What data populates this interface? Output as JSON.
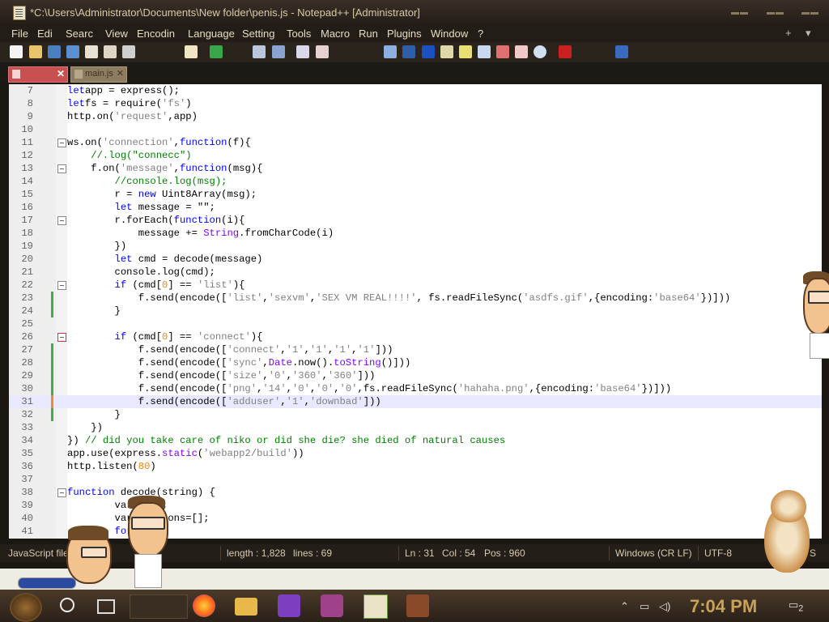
{
  "window": {
    "title": "*C:\\Users\\Administrator\\Documents\\New folder\\penis.js - Notepad++ [Administrator]"
  },
  "menu": {
    "items": [
      "File",
      "Edi",
      "Searc",
      "View",
      "Encodin",
      "Language",
      "Setting",
      "Tools",
      "Macro",
      "Run",
      "Plugins",
      "Window",
      "?"
    ],
    "right": [
      "+",
      "▾",
      "✕"
    ]
  },
  "tabs": [
    {
      "label": "",
      "active": true,
      "color": "#c95050"
    },
    {
      "label": "main.js",
      "active": false
    }
  ],
  "editor": {
    "current_line": 31,
    "lines": [
      {
        "n": 7,
        "t": [
          [
            "k",
            "let"
          ],
          [
            "",
            "app = express();"
          ]
        ]
      },
      {
        "n": 8,
        "t": [
          [
            "k",
            "let"
          ],
          [
            "",
            "fs = require("
          ],
          [
            "s",
            "'fs'"
          ],
          [
            "",
            ")"
          ]
        ]
      },
      {
        "n": 9,
        "t": [
          [
            "",
            "http.on("
          ],
          [
            "s",
            "'request'"
          ],
          [
            "",
            ",app)"
          ]
        ]
      },
      {
        "n": 10,
        "t": []
      },
      {
        "n": 11,
        "t": [
          [
            "",
            "ws.on("
          ],
          [
            "s",
            "'connection'"
          ],
          [
            "",
            ","
          ],
          [
            "k",
            "function"
          ],
          [
            "",
            "(f){"
          ]
        ],
        "fold": true
      },
      {
        "n": 12,
        "t": [
          [
            "c",
            "    //.log(\"connecc\")"
          ]
        ]
      },
      {
        "n": 13,
        "t": [
          [
            "",
            "    f.on("
          ],
          [
            "s",
            "'message'"
          ],
          [
            "",
            ","
          ],
          [
            "k",
            "function"
          ],
          [
            "",
            "(msg){"
          ]
        ],
        "fold": true
      },
      {
        "n": 14,
        "t": [
          [
            "c",
            "        //console.log(msg);"
          ]
        ]
      },
      {
        "n": 15,
        "t": [
          [
            "",
            "        r = "
          ],
          [
            "k",
            "new"
          ],
          [
            "",
            " Uint8Array(msg);"
          ]
        ]
      },
      {
        "n": 16,
        "t": [
          [
            "k",
            "        let"
          ],
          [
            "",
            " message = \"\";"
          ]
        ]
      },
      {
        "n": 17,
        "t": [
          [
            "",
            "        r.forEach("
          ],
          [
            "k",
            "function"
          ],
          [
            "",
            "(i){"
          ]
        ],
        "fold": true
      },
      {
        "n": 18,
        "t": [
          [
            "",
            "            message += "
          ],
          [
            "f",
            "String"
          ],
          [
            "",
            ".fromCharCode(i)"
          ]
        ]
      },
      {
        "n": 19,
        "t": [
          [
            "",
            "        })"
          ]
        ]
      },
      {
        "n": 20,
        "t": [
          [
            "k",
            "        let"
          ],
          [
            "",
            " cmd = decode(message)"
          ]
        ]
      },
      {
        "n": 21,
        "t": [
          [
            "",
            "        console.log(cmd);"
          ]
        ]
      },
      {
        "n": 22,
        "t": [
          [
            "k",
            "        if"
          ],
          [
            "",
            " (cmd["
          ],
          [
            "n",
            "0"
          ],
          [
            "",
            "] == "
          ],
          [
            "s",
            "'list'"
          ],
          [
            "",
            "){"
          ]
        ],
        "fold": true
      },
      {
        "n": 23,
        "t": [
          [
            "",
            "            f.send(encode(["
          ],
          [
            "s",
            "'list'"
          ],
          [
            "",
            ","
          ],
          [
            "s",
            "'sexvm'"
          ],
          [
            "",
            ","
          ],
          [
            "s",
            "'SEX VM REAL!!!!'"
          ],
          [
            "",
            ", fs.readFileSync("
          ],
          [
            "s",
            "'asdfs.gif'"
          ],
          [
            "",
            ",{encoding:"
          ],
          [
            "s",
            "'base64'"
          ],
          [
            "",
            "})]))"
          ]
        ],
        "mark": "#3cb043"
      },
      {
        "n": 24,
        "t": [
          [
            "",
            "        }"
          ]
        ],
        "mark": "#3cb043"
      },
      {
        "n": 25,
        "t": []
      },
      {
        "n": 26,
        "t": [
          [
            "k",
            "        if"
          ],
          [
            "",
            " (cmd["
          ],
          [
            "n",
            "0"
          ],
          [
            "",
            "] == "
          ],
          [
            "s",
            "'connect'"
          ],
          [
            "",
            "){"
          ]
        ],
        "fold": true,
        "foldRed": true
      },
      {
        "n": 27,
        "t": [
          [
            "",
            "            f.send(encode(["
          ],
          [
            "s",
            "'connect'"
          ],
          [
            "",
            ","
          ],
          [
            "s",
            "'1'"
          ],
          [
            "",
            ","
          ],
          [
            "s",
            "'1'"
          ],
          [
            "",
            ","
          ],
          [
            "s",
            "'1'"
          ],
          [
            "",
            ","
          ],
          [
            "s",
            "'1'"
          ],
          [
            "",
            "]))"
          ]
        ],
        "mark": "#3cb043"
      },
      {
        "n": 28,
        "t": [
          [
            "",
            "            f.send(encode(["
          ],
          [
            "s",
            "'sync'"
          ],
          [
            "",
            ","
          ],
          [
            "f",
            "Date"
          ],
          [
            "",
            ".now()."
          ],
          [
            "f",
            "toString"
          ],
          [
            "",
            "()]))"
          ]
        ],
        "mark": "#3cb043"
      },
      {
        "n": 29,
        "t": [
          [
            "",
            "            f.send(encode(["
          ],
          [
            "s",
            "'size'"
          ],
          [
            "",
            ","
          ],
          [
            "s",
            "'0'"
          ],
          [
            "",
            ","
          ],
          [
            "s",
            "'360'"
          ],
          [
            "",
            ","
          ],
          [
            "s",
            "'360'"
          ],
          [
            "",
            "]))"
          ]
        ],
        "mark": "#3cb043"
      },
      {
        "n": 30,
        "t": [
          [
            "",
            "            f.send(encode(["
          ],
          [
            "s",
            "'png'"
          ],
          [
            "",
            ","
          ],
          [
            "s",
            "'14'"
          ],
          [
            "",
            ","
          ],
          [
            "s",
            "'0'"
          ],
          [
            "",
            ","
          ],
          [
            "s",
            "'0'"
          ],
          [
            "",
            ","
          ],
          [
            "s",
            "'0'"
          ],
          [
            "",
            ",fs.readFileSync("
          ],
          [
            "s",
            "'hahaha.png'"
          ],
          [
            "",
            ",{encoding:"
          ],
          [
            "s",
            "'base64'"
          ],
          [
            "",
            "})]))"
          ]
        ],
        "mark": "#3cb043"
      },
      {
        "n": 31,
        "t": [
          [
            "",
            "            f.send(encode(["
          ],
          [
            "s",
            "'adduser'"
          ],
          [
            "",
            ","
          ],
          [
            "s",
            "'1'"
          ],
          [
            "",
            ","
          ],
          [
            "s",
            "'downbad'"
          ],
          [
            "",
            "]))"
          ]
        ],
        "mark": "#f08a24"
      },
      {
        "n": 32,
        "t": [
          [
            "",
            "        }"
          ]
        ],
        "mark": "#3cb043"
      },
      {
        "n": 33,
        "t": [
          [
            "",
            "    })"
          ]
        ]
      },
      {
        "n": 34,
        "t": [
          [
            "",
            "}) "
          ],
          [
            "c",
            "// did you take care of niko or did she die? she died of natural causes"
          ]
        ]
      },
      {
        "n": 35,
        "t": [
          [
            "",
            "app.use(express."
          ],
          [
            "f",
            "static"
          ],
          [
            "",
            "("
          ],
          [
            "s",
            "'webapp2/build'"
          ],
          [
            "",
            "))"
          ]
        ]
      },
      {
        "n": 36,
        "t": [
          [
            "",
            "http.listen("
          ],
          [
            "n",
            "80"
          ],
          [
            "",
            ")"
          ]
        ]
      },
      {
        "n": 37,
        "t": []
      },
      {
        "n": 38,
        "t": [
          [
            "k",
            "function"
          ],
          [
            "",
            " decode(string) {"
          ]
        ],
        "fold": true
      },
      {
        "n": 39,
        "t": [
          [
            "",
            "        va"
          ],
          [
            "",
            "r x=-"
          ],
          [
            "n",
            "1"
          ],
          [
            "",
            ";"
          ]
        ]
      },
      {
        "n": 40,
        "t": [
          [
            "",
            "        va"
          ],
          [
            "",
            "r sections=[];"
          ]
        ]
      },
      {
        "n": 41,
        "t": [
          [
            "k",
            "        fo"
          ],
          [
            "",
            "r(){"
          ]
        ]
      }
    ]
  },
  "status": {
    "file_type": "JavaScript file",
    "length": "length : 1,828",
    "lines": "lines : 69",
    "ln": "Ln : 31",
    "col": "Col : 54",
    "pos": "Pos : 960",
    "eol": "Windows (CR LF)",
    "encoding": "UTF-8",
    "mode": "S"
  },
  "taskbar": {
    "clock": "7:04 PM",
    "notifications": "2",
    "apps": [
      "firefox-icon",
      "file-explorer-icon",
      "visual-studio-icon",
      "app-icon",
      "notepad-plus-plus-icon",
      "app-icon-2"
    ]
  },
  "colors": {
    "keyword": "#0000ff",
    "string": "#808080",
    "number": "#ff8000",
    "comment": "#008000",
    "builtin": "#8000ff",
    "change_saved": "#3cb043",
    "change_unsaved": "#f08a24",
    "clock": "#c9a25a"
  }
}
